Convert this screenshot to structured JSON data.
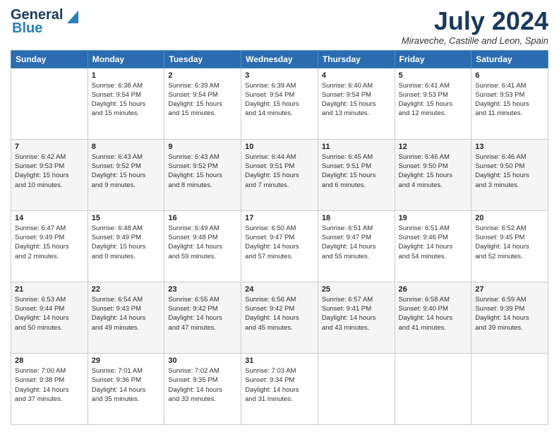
{
  "header": {
    "logo_general": "General",
    "logo_blue": "Blue",
    "month_year": "July 2024",
    "location": "Miraveche, Castille and Leon, Spain"
  },
  "days_of_week": [
    "Sunday",
    "Monday",
    "Tuesday",
    "Wednesday",
    "Thursday",
    "Friday",
    "Saturday"
  ],
  "weeks": [
    [
      {
        "day": "",
        "info": ""
      },
      {
        "day": "1",
        "info": "Sunrise: 6:38 AM\nSunset: 9:54 PM\nDaylight: 15 hours\nand 15 minutes."
      },
      {
        "day": "2",
        "info": "Sunrise: 6:39 AM\nSunset: 9:54 PM\nDaylight: 15 hours\nand 15 minutes."
      },
      {
        "day": "3",
        "info": "Sunrise: 6:39 AM\nSunset: 9:54 PM\nDaylight: 15 hours\nand 14 minutes."
      },
      {
        "day": "4",
        "info": "Sunrise: 6:40 AM\nSunset: 9:54 PM\nDaylight: 15 hours\nand 13 minutes."
      },
      {
        "day": "5",
        "info": "Sunrise: 6:41 AM\nSunset: 9:53 PM\nDaylight: 15 hours\nand 12 minutes."
      },
      {
        "day": "6",
        "info": "Sunrise: 6:41 AM\nSunset: 9:53 PM\nDaylight: 15 hours\nand 11 minutes."
      }
    ],
    [
      {
        "day": "7",
        "info": "Sunrise: 6:42 AM\nSunset: 9:53 PM\nDaylight: 15 hours\nand 10 minutes."
      },
      {
        "day": "8",
        "info": "Sunrise: 6:43 AM\nSunset: 9:52 PM\nDaylight: 15 hours\nand 9 minutes."
      },
      {
        "day": "9",
        "info": "Sunrise: 6:43 AM\nSunset: 9:52 PM\nDaylight: 15 hours\nand 8 minutes."
      },
      {
        "day": "10",
        "info": "Sunrise: 6:44 AM\nSunset: 9:51 PM\nDaylight: 15 hours\nand 7 minutes."
      },
      {
        "day": "11",
        "info": "Sunrise: 6:45 AM\nSunset: 9:51 PM\nDaylight: 15 hours\nand 6 minutes."
      },
      {
        "day": "12",
        "info": "Sunrise: 6:46 AM\nSunset: 9:50 PM\nDaylight: 15 hours\nand 4 minutes."
      },
      {
        "day": "13",
        "info": "Sunrise: 6:46 AM\nSunset: 9:50 PM\nDaylight: 15 hours\nand 3 minutes."
      }
    ],
    [
      {
        "day": "14",
        "info": "Sunrise: 6:47 AM\nSunset: 9:49 PM\nDaylight: 15 hours\nand 2 minutes."
      },
      {
        "day": "15",
        "info": "Sunrise: 6:48 AM\nSunset: 9:49 PM\nDaylight: 15 hours\nand 0 minutes."
      },
      {
        "day": "16",
        "info": "Sunrise: 6:49 AM\nSunset: 9:48 PM\nDaylight: 14 hours\nand 59 minutes."
      },
      {
        "day": "17",
        "info": "Sunrise: 6:50 AM\nSunset: 9:47 PM\nDaylight: 14 hours\nand 57 minutes."
      },
      {
        "day": "18",
        "info": "Sunrise: 6:51 AM\nSunset: 9:47 PM\nDaylight: 14 hours\nand 55 minutes."
      },
      {
        "day": "19",
        "info": "Sunrise: 6:51 AM\nSunset: 9:46 PM\nDaylight: 14 hours\nand 54 minutes."
      },
      {
        "day": "20",
        "info": "Sunrise: 6:52 AM\nSunset: 9:45 PM\nDaylight: 14 hours\nand 52 minutes."
      }
    ],
    [
      {
        "day": "21",
        "info": "Sunrise: 6:53 AM\nSunset: 9:44 PM\nDaylight: 14 hours\nand 50 minutes."
      },
      {
        "day": "22",
        "info": "Sunrise: 6:54 AM\nSunset: 9:43 PM\nDaylight: 14 hours\nand 49 minutes."
      },
      {
        "day": "23",
        "info": "Sunrise: 6:55 AM\nSunset: 9:42 PM\nDaylight: 14 hours\nand 47 minutes."
      },
      {
        "day": "24",
        "info": "Sunrise: 6:56 AM\nSunset: 9:42 PM\nDaylight: 14 hours\nand 45 minutes."
      },
      {
        "day": "25",
        "info": "Sunrise: 6:57 AM\nSunset: 9:41 PM\nDaylight: 14 hours\nand 43 minutes."
      },
      {
        "day": "26",
        "info": "Sunrise: 6:58 AM\nSunset: 9:40 PM\nDaylight: 14 hours\nand 41 minutes."
      },
      {
        "day": "27",
        "info": "Sunrise: 6:59 AM\nSunset: 9:39 PM\nDaylight: 14 hours\nand 39 minutes."
      }
    ],
    [
      {
        "day": "28",
        "info": "Sunrise: 7:00 AM\nSunset: 9:38 PM\nDaylight: 14 hours\nand 37 minutes."
      },
      {
        "day": "29",
        "info": "Sunrise: 7:01 AM\nSunset: 9:36 PM\nDaylight: 14 hours\nand 35 minutes."
      },
      {
        "day": "30",
        "info": "Sunrise: 7:02 AM\nSunset: 9:35 PM\nDaylight: 14 hours\nand 33 minutes."
      },
      {
        "day": "31",
        "info": "Sunrise: 7:03 AM\nSunset: 9:34 PM\nDaylight: 14 hours\nand 31 minutes."
      },
      {
        "day": "",
        "info": ""
      },
      {
        "day": "",
        "info": ""
      },
      {
        "day": "",
        "info": ""
      }
    ]
  ]
}
